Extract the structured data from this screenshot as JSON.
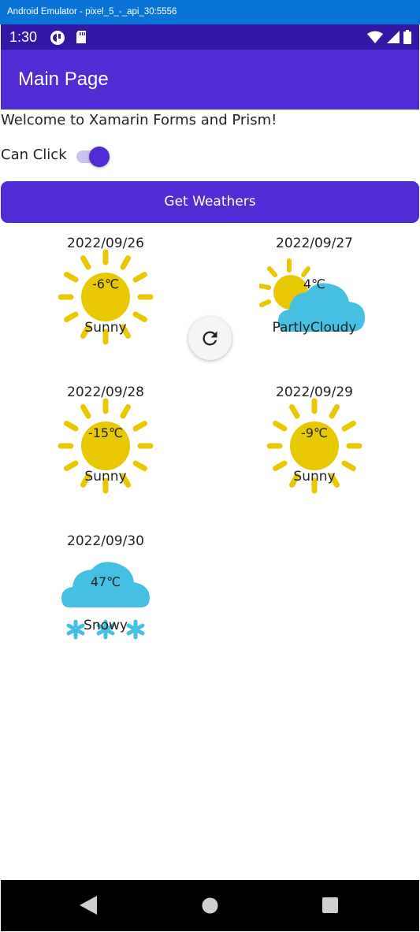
{
  "window": {
    "title": "Android Emulator - pixel_5_-_api_30:5556"
  },
  "status_bar": {
    "time": "1:30",
    "left_icons": [
      "app-notification-icon",
      "sd-card-icon"
    ],
    "right_icons": [
      "wifi-icon",
      "signal-icon",
      "battery-icon"
    ]
  },
  "toolbar": {
    "title": "Main Page"
  },
  "welcome_text": "Welcome to Xamarin Forms and Prism!",
  "can_click": {
    "label": "Can Click",
    "enabled": true
  },
  "get_weathers_button": {
    "label": "Get Weathers"
  },
  "weathers": [
    {
      "date": "2022/09/26",
      "temperature": "-6℃",
      "condition": "Sunny",
      "icon": "sunny-icon"
    },
    {
      "date": "2022/09/27",
      "temperature": "4℃",
      "condition": "PartlyCloudy",
      "icon": "partly-cloudy-icon"
    },
    {
      "date": "2022/09/28",
      "temperature": "-15℃",
      "condition": "Sunny",
      "icon": "sunny-icon"
    },
    {
      "date": "2022/09/29",
      "temperature": "-9℃",
      "condition": "Sunny",
      "icon": "sunny-icon"
    },
    {
      "date": "2022/09/30",
      "temperature": "47℃",
      "condition": "Snowy",
      "icon": "snowy-icon"
    }
  ],
  "refresh_indicator": {
    "icon": "refresh-icon"
  },
  "colors": {
    "primary": "#512bd4",
    "status_bar": "#3218a4",
    "sun": "#e8c800",
    "cloud": "#45c0e2"
  },
  "nav_bar": {
    "icons": [
      "back-icon",
      "home-icon",
      "recents-icon"
    ]
  }
}
